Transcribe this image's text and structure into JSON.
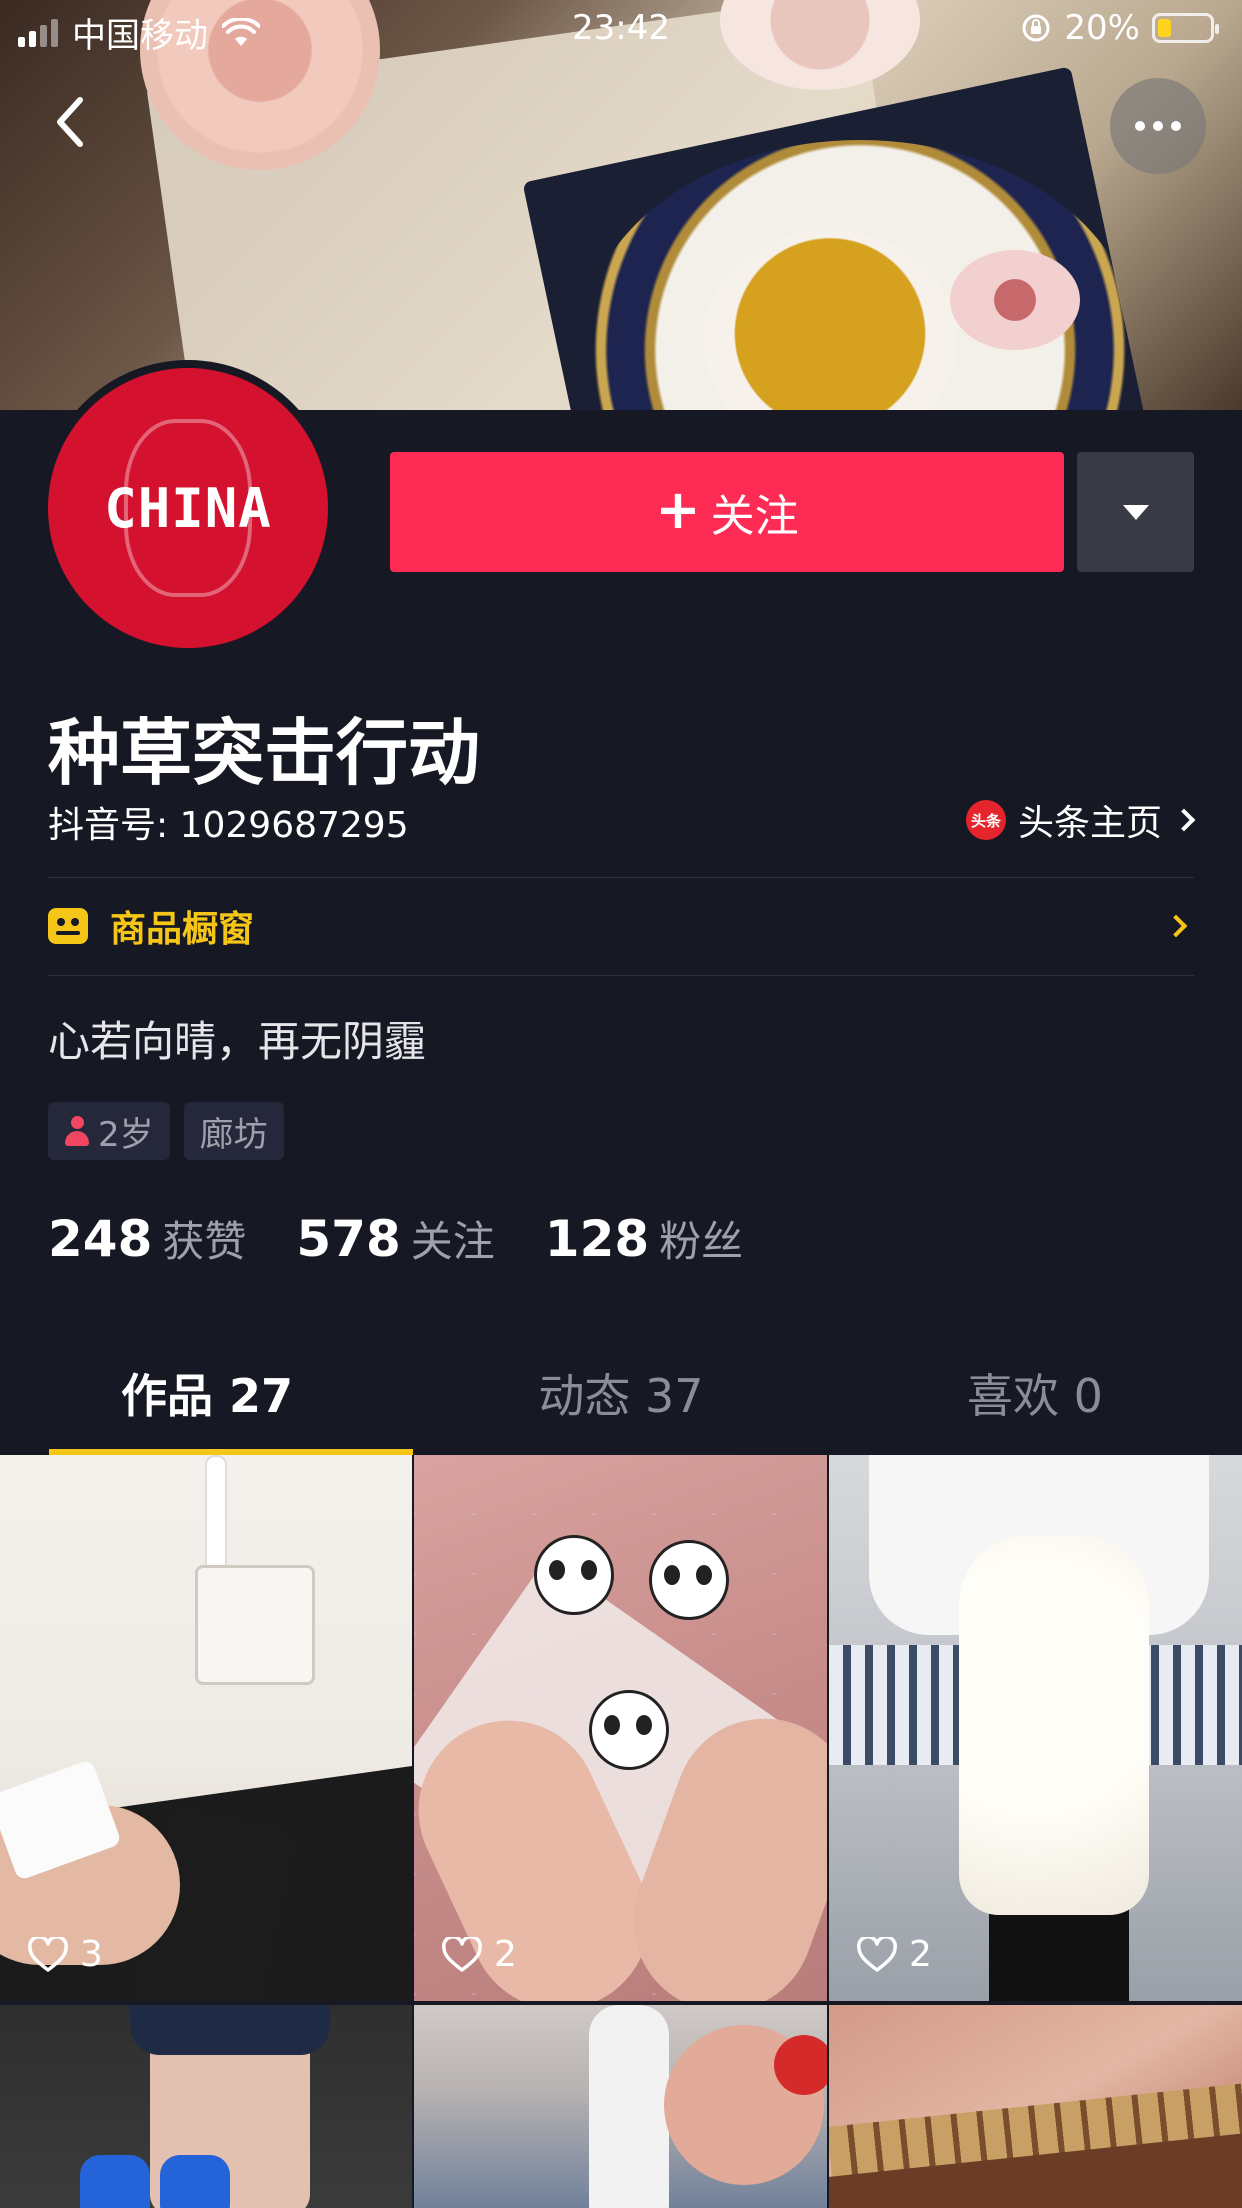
{
  "status_bar": {
    "carrier": "中国移动",
    "time": "23:42",
    "battery": "20%"
  },
  "profile": {
    "avatar_text": "CHINA",
    "follow_label": "关注",
    "nickname": "种草突击行动",
    "douyin_id": "抖音号: 1029687295",
    "toutiao_label": "头条主页",
    "toutiao_icon_text": "头条",
    "shop_label": "商品橱窗",
    "bio": "心若向晴，再无阴霾",
    "tags": [
      {
        "label": "2岁",
        "icon": "person-icon"
      },
      {
        "label": "廊坊"
      }
    ],
    "stats": [
      {
        "num": "248",
        "label": "获赞"
      },
      {
        "num": "578",
        "label": "关注"
      },
      {
        "num": "128",
        "label": "粉丝"
      }
    ]
  },
  "tabs": [
    {
      "label": "作品 27",
      "active": true
    },
    {
      "label": "动态 37",
      "active": false
    },
    {
      "label": "喜欢 0",
      "active": false
    }
  ],
  "videos": [
    {
      "likes": "3"
    },
    {
      "likes": "2"
    },
    {
      "likes": "2"
    }
  ],
  "colors": {
    "background": "#161823",
    "follow_button": "#fe2c55",
    "accent_yellow": "#f5c518",
    "secondary_text": "#9ea0ac"
  },
  "icons": [
    "back-icon",
    "more-icon",
    "dropdown-caret-icon",
    "toutiao-icon",
    "shop-icon",
    "person-icon",
    "heart-icon",
    "wifi-icon",
    "signal-icon",
    "battery-icon",
    "rotation-lock-icon"
  ]
}
